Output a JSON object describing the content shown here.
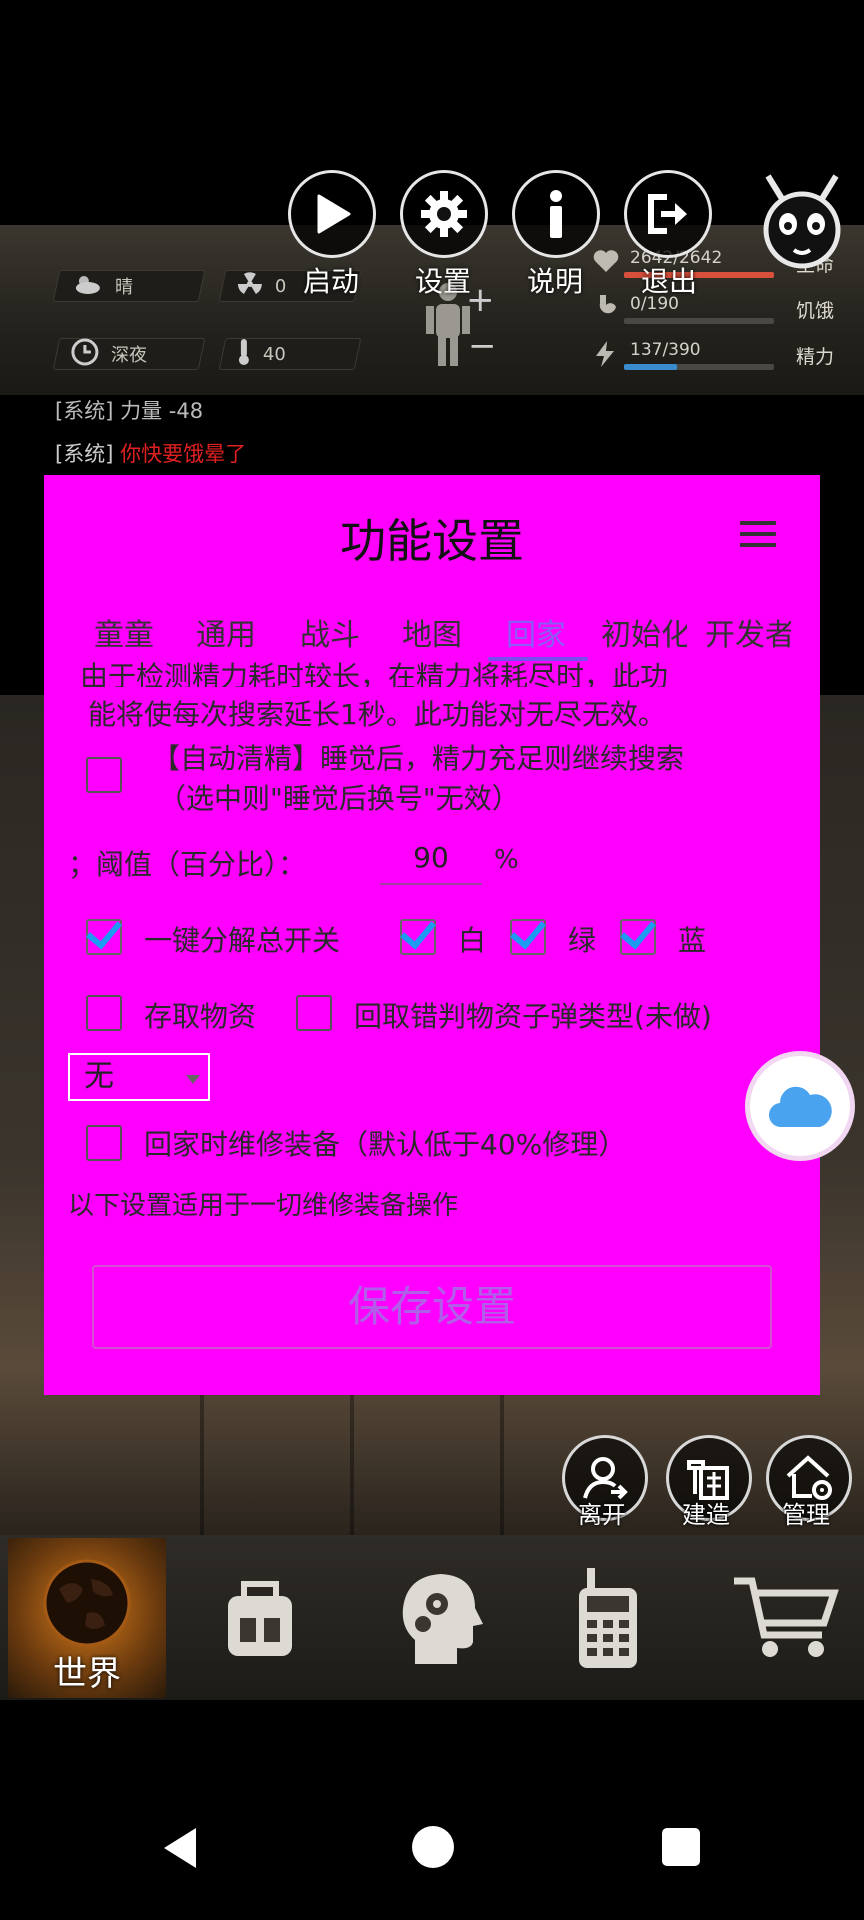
{
  "top_buttons": [
    {
      "label": "启动",
      "icon": "play-icon"
    },
    {
      "label": "设置",
      "icon": "gear-icon"
    },
    {
      "label": "说明",
      "icon": "info-icon"
    },
    {
      "label": "退出",
      "icon": "exit-icon"
    }
  ],
  "status": {
    "weather": "晴",
    "radiation": "0",
    "time": "深夜",
    "temperature": "40"
  },
  "bars": {
    "health": {
      "text": "2642/2642",
      "label": "生命",
      "fraction": 1.0,
      "color": "#d8503c"
    },
    "hunger": {
      "text": "0/190",
      "label": "饥饿",
      "fraction": 0.0,
      "color": "#a0a09a"
    },
    "energy": {
      "text": "137/390",
      "label": "精力",
      "fraction": 0.35,
      "color": "#3a8ccf"
    }
  },
  "log": {
    "line1_tag": "[系统]",
    "line1_text": "力量 -48",
    "line2_tag": "[系统]",
    "line2_text": "你快要饿晕了",
    "line2_color": "#e02020"
  },
  "dialog": {
    "title": "功能设置",
    "tabs": [
      "童童",
      "通用",
      "战斗",
      "地图",
      "回家",
      "初始化",
      "开发者"
    ],
    "active_tab": "回家",
    "desc_line1": "由于检测精力耗时较长，在精力将耗尽时，此功",
    "desc_line2": "能将使每次搜索延长1秒。此功能对无尽无效。",
    "auto_sleep_line1": "【自动清精】睡觉后，精力充足则继续搜索",
    "auto_sleep_line2": "（选中则\"睡觉后换号\"无效）",
    "threshold_label": "；阈值（百分比）：",
    "threshold_value": "90",
    "threshold_unit": "%",
    "decompose_all": "一键分解总开关",
    "decompose_white": "白",
    "decompose_green": "绿",
    "decompose_blue": "蓝",
    "store_items": "存取物资",
    "retrieve_ammo": "回取错判物资子弹类型(未做)",
    "select_value": "无",
    "repair_home": "回家时维修装备（默认低于40%修理）",
    "repair_note": "以下设置适用于一切维修装备操作",
    "save_button": "保存设置",
    "checks": {
      "auto_sleep": false,
      "decompose_all": true,
      "white": true,
      "green": true,
      "blue": true,
      "store_items": false,
      "retrieve_ammo": false,
      "repair_home": false
    }
  },
  "actions": [
    {
      "label": "离开",
      "icon": "leave-person-icon"
    },
    {
      "label": "建造",
      "icon": "build-hammer-icon"
    },
    {
      "label": "管理",
      "icon": "manage-house-icon"
    }
  ],
  "nav": {
    "world_label": "世界",
    "items": [
      "world-globe-icon",
      "backpack-icon",
      "brain-gear-icon",
      "walkie-talkie-icon",
      "cart-icon"
    ]
  },
  "android": [
    "back-icon",
    "home-icon",
    "recents-icon"
  ]
}
